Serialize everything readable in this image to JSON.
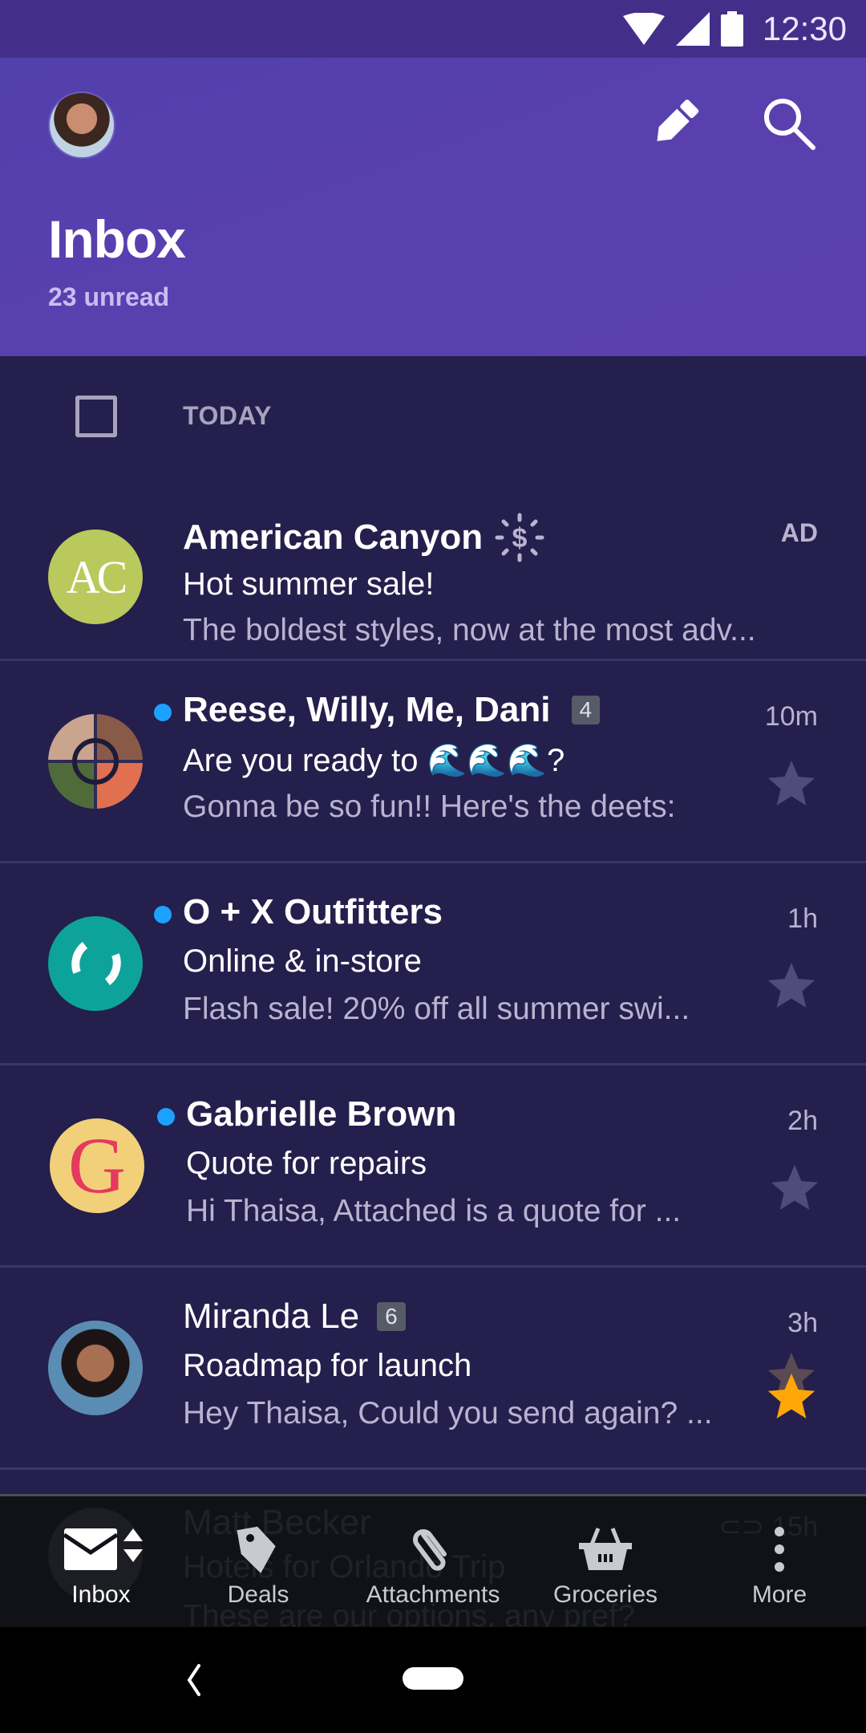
{
  "status_bar": {
    "time": "12:30",
    "icons": [
      "wifi-icon",
      "cell-signal-icon",
      "battery-icon"
    ]
  },
  "header": {
    "title": "Inbox",
    "unread": "23 unread",
    "actions": [
      "compose-icon",
      "search-icon"
    ]
  },
  "list": {
    "section_label": "TODAY",
    "emails": [
      {
        "sender": "American Canyon",
        "subject": "Hot summer sale!",
        "snippet": "The boldest styles, now at the most adv...",
        "time": "AD",
        "is_ad": true,
        "unread": false,
        "avatar_initials": "AC",
        "avatar_color": "#b9c95b"
      },
      {
        "sender": "Reese, Willy, Me, Dani",
        "count": "4",
        "subject": "Are you ready to 🌊🌊🌊?",
        "snippet": "Gonna be so fun!! Here's the deets:",
        "time": "10m",
        "unread": true,
        "starred": false
      },
      {
        "sender": "O + X Outfitters",
        "subject": "Online & in-store",
        "snippet": "Flash sale! 20% off all summer swi...",
        "time": "1h",
        "unread": true,
        "starred": false,
        "avatar_color": "#0ea39a"
      },
      {
        "sender": "Gabrielle Brown",
        "subject": "Quote for repairs",
        "snippet": "Hi Thaisa, Attached is a quote for ...",
        "time": "2h",
        "unread": true,
        "starred": false,
        "avatar_initials": "G",
        "avatar_color": "#f2d07a"
      },
      {
        "sender": "Miranda Le",
        "count": "6",
        "subject": "Roadmap for launch",
        "snippet": "Hey Thaisa, Could you send again? ...",
        "time": "3h",
        "unread": false,
        "starred": true
      },
      {
        "sender": "Matt Becker",
        "subject": "Hotels for Orlando Trip",
        "snippet": "These are our options, any pref?",
        "time": "15h",
        "has_attachment": true
      }
    ]
  },
  "bottom_nav": {
    "items": [
      {
        "label": "Inbox",
        "icon": "inbox-icon",
        "active": true
      },
      {
        "label": "Deals",
        "icon": "tag-icon"
      },
      {
        "label": "Attachments",
        "icon": "paperclip-icon"
      },
      {
        "label": "Groceries",
        "icon": "basket-icon"
      },
      {
        "label": "More",
        "icon": "more-vertical-icon"
      }
    ]
  },
  "colors": {
    "header_bg": "#5443ae",
    "list_bg": "#241f4c",
    "unread_dot": "#1da1ff",
    "star_active": "#ffa707",
    "star_inactive": "#4f4c7a"
  }
}
